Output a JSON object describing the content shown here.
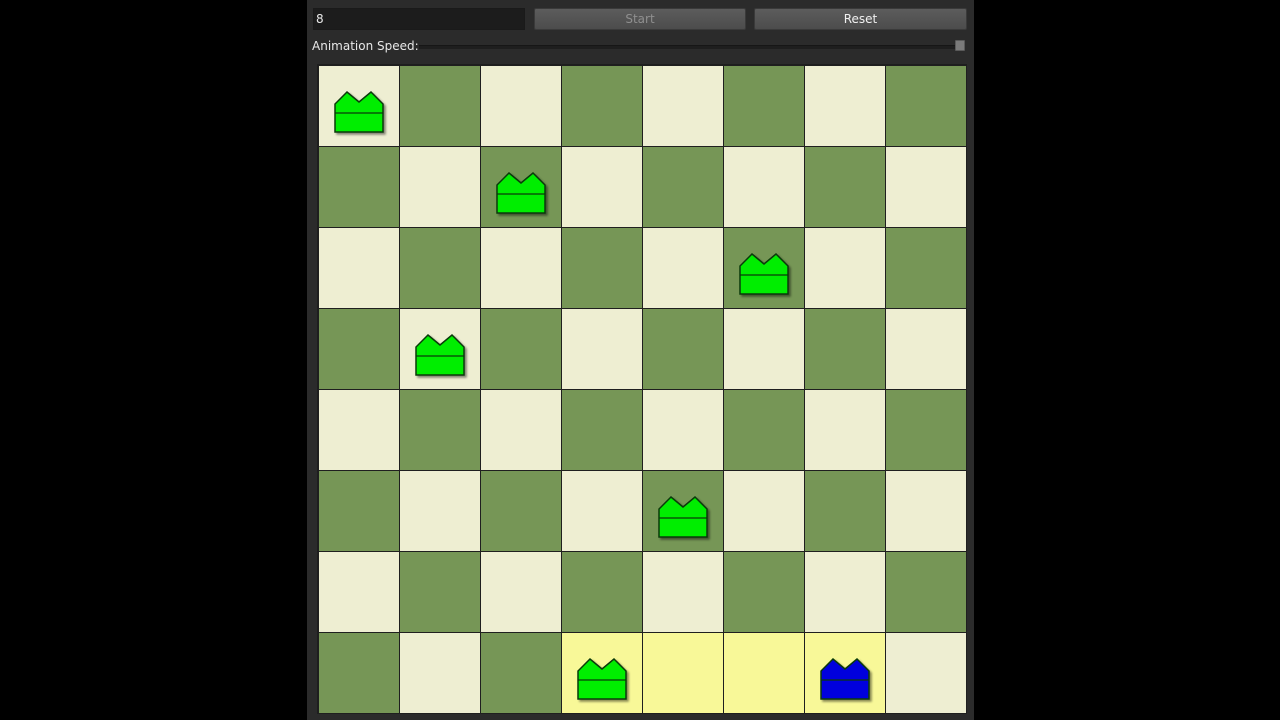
{
  "controls": {
    "n_value": "8",
    "start_label": "Start",
    "reset_label": "Reset",
    "speed_label": "Animation Speed:",
    "speed_level": 1.0
  },
  "board": {
    "size": 8,
    "colors": {
      "light": "#eeeed2",
      "dark": "#769656",
      "highlight": "#f8f898",
      "queen_placed": "#00ee00",
      "queen_active": "#0000dd"
    },
    "queens": [
      {
        "row": 0,
        "col": 0,
        "state": "placed"
      },
      {
        "row": 1,
        "col": 2,
        "state": "placed"
      },
      {
        "row": 2,
        "col": 5,
        "state": "placed"
      },
      {
        "row": 3,
        "col": 1,
        "state": "placed"
      },
      {
        "row": 5,
        "col": 4,
        "state": "placed"
      },
      {
        "row": 7,
        "col": 3,
        "state": "placed"
      },
      {
        "row": 7,
        "col": 6,
        "state": "active"
      }
    ],
    "highlighted_cells": [
      {
        "row": 7,
        "col": 3
      },
      {
        "row": 7,
        "col": 4
      },
      {
        "row": 7,
        "col": 5
      },
      {
        "row": 7,
        "col": 6
      }
    ]
  },
  "icons": {
    "queen": "crown-piece-icon",
    "speed_handle": "slider-handle"
  }
}
